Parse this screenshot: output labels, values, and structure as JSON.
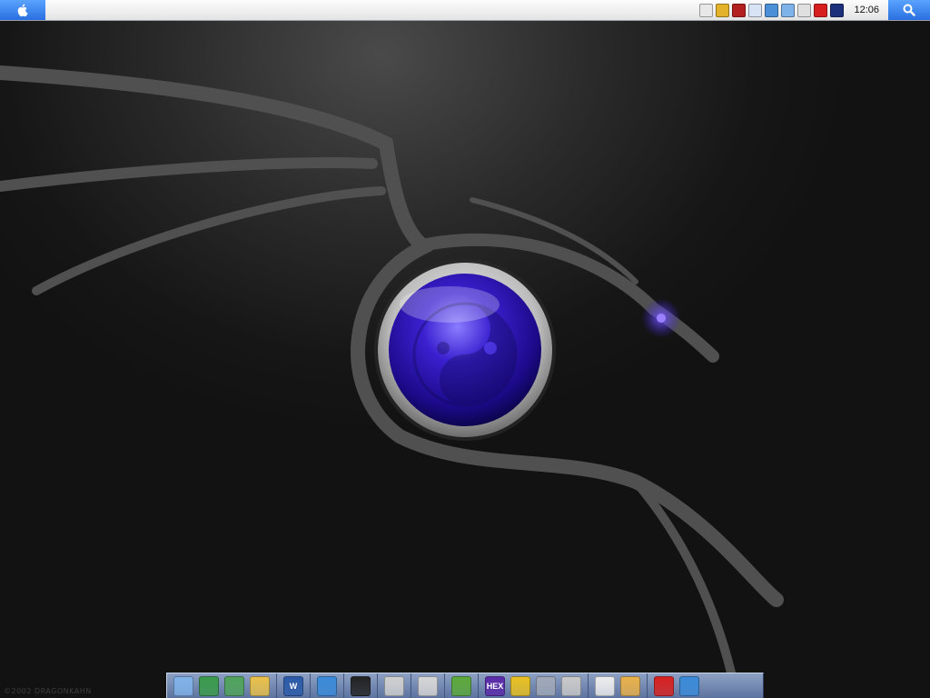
{
  "menubar": {
    "apple_icon": "apple-icon",
    "search_icon": "magnifier-icon",
    "clock": "12:06",
    "tray_icons": [
      {
        "name": "phone-icon",
        "color": "#e8e8e8"
      },
      {
        "name": "globe-icon",
        "color": "#e3b22a"
      },
      {
        "name": "fax-icon",
        "color": "#b32020"
      },
      {
        "name": "window-icon",
        "color": "#d8e4f5"
      },
      {
        "name": "network-icon",
        "color": "#4a8fd8"
      },
      {
        "name": "disk-icon",
        "color": "#7fb2e8"
      },
      {
        "name": "volume-icon",
        "color": "#e0e0e0"
      },
      {
        "name": "power-icon",
        "color": "#d81f1f"
      },
      {
        "name": "target-icon",
        "color": "#1b2f7a"
      }
    ]
  },
  "wallpaper": {
    "orb_color": "#3a20d0",
    "eye_color": "#6a40ff",
    "watermark": "©2002 DRAGONKAHN"
  },
  "dock": {
    "groups": [
      [
        {
          "name": "my-computer-icon",
          "color": "#7fb2e8"
        },
        {
          "name": "network-places-icon",
          "color": "#3a9a4a"
        },
        {
          "name": "recycle-icon",
          "color": "#4fa35a"
        },
        {
          "name": "folder-icon",
          "color": "#e8c04a"
        }
      ],
      [
        {
          "name": "word-icon",
          "color": "#2a5aa8",
          "label": "W"
        }
      ],
      [
        {
          "name": "internet-explorer-icon",
          "color": "#3a8ad8"
        }
      ],
      [
        {
          "name": "command-prompt-icon",
          "color": "#222222"
        }
      ],
      [
        {
          "name": "media-player-icon",
          "color": "#cfcfcf"
        }
      ],
      [
        {
          "name": "cd-burner-icon",
          "color": "#d5d5d5"
        }
      ],
      [
        {
          "name": "paint-icon",
          "color": "#5aa83a"
        }
      ],
      [
        {
          "name": "hex-editor-icon",
          "color": "#5a2aa8",
          "label": "HEX"
        },
        {
          "name": "gear-icon",
          "color": "#e8c020"
        },
        {
          "name": "scanner-icon",
          "color": "#a0a8b8"
        },
        {
          "name": "archive-icon",
          "color": "#c8c8c8"
        }
      ],
      [
        {
          "name": "notepad-icon",
          "color": "#ececec"
        },
        {
          "name": "open-folder-icon",
          "color": "#e8b04a"
        }
      ],
      [
        {
          "name": "no-entry-icon",
          "color": "#d82020"
        },
        {
          "name": "display-settings-icon",
          "color": "#3a8ad8"
        }
      ]
    ]
  }
}
